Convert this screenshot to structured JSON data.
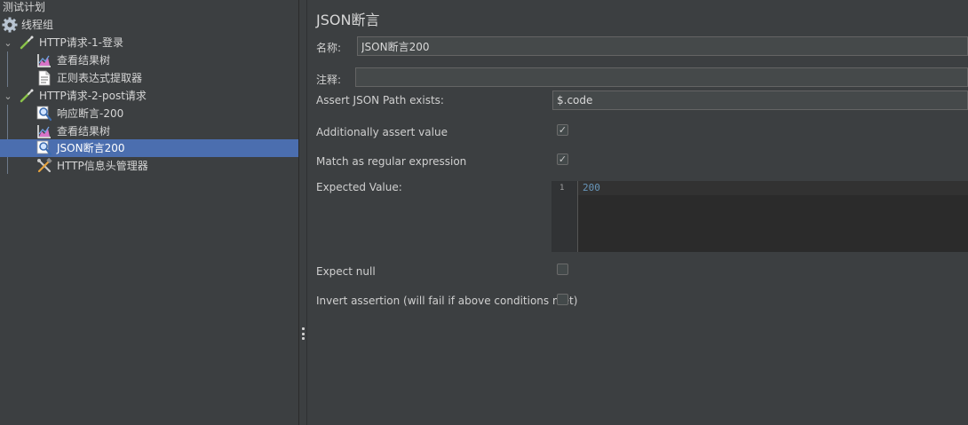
{
  "tree": {
    "nodes": [
      {
        "label": "测试计划",
        "icon": "none"
      },
      {
        "label": "线程组",
        "icon": "gear-icon"
      },
      {
        "label": "HTTP请求-1-登录",
        "icon": "pipette-icon",
        "expander": "chevron-down-icon"
      },
      {
        "label": "查看结果树",
        "icon": "graph-results-icon"
      },
      {
        "label": "正则表达式提取器",
        "icon": "document-icon"
      },
      {
        "label": "HTTP请求-2-post请求",
        "icon": "pipette-icon",
        "expander": "chevron-down-icon"
      },
      {
        "label": "响应断言-200",
        "icon": "magnifier-icon"
      },
      {
        "label": "查看结果树",
        "icon": "graph-results-icon"
      },
      {
        "label": "JSON断言200",
        "icon": "magnifier-icon",
        "selected": true
      },
      {
        "label": "HTTP信息头管理器",
        "icon": "tools-icon"
      }
    ]
  },
  "panel": {
    "title": "JSON断言",
    "name_label": "名称:",
    "name_value": "JSON断言200",
    "comment_label": "注释:",
    "comment_value": "",
    "path_label": "Assert JSON Path exists:",
    "path_value": "$.code",
    "assert_value_label": "Additionally assert value",
    "assert_value_checked": true,
    "regex_label": "Match as regular expression",
    "regex_checked": true,
    "expected_label": "Expected Value:",
    "expected_line_number": "1",
    "expected_value": "200",
    "expect_null_label": "Expect null",
    "expect_null_checked": false,
    "invert_label": "Invert assertion (will fail if above conditions met)",
    "invert_checked": false
  },
  "colors": {
    "background": "#3c3f41",
    "selection": "#4b6eaf",
    "editor_bg": "#2b2b2b",
    "code_number": "#6897bb"
  }
}
